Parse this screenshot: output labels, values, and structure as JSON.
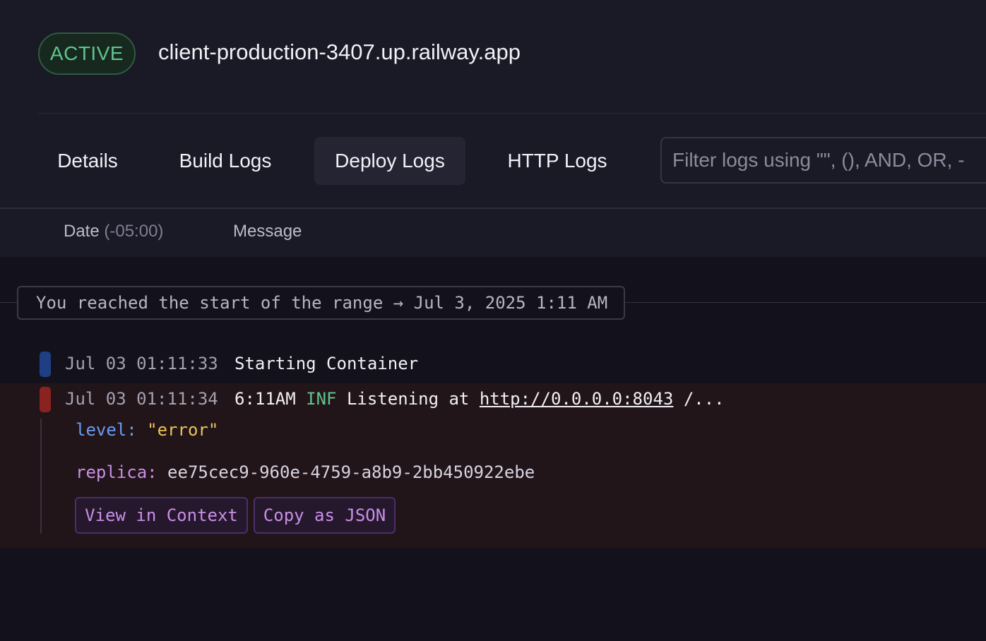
{
  "header": {
    "status_badge": "ACTIVE",
    "url": "client-production-3407.up.railway.app"
  },
  "tabs": [
    {
      "label": "Details",
      "active": false
    },
    {
      "label": "Build Logs",
      "active": false
    },
    {
      "label": "Deploy Logs",
      "active": true
    },
    {
      "label": "HTTP Logs",
      "active": false
    }
  ],
  "filter": {
    "placeholder": "Filter logs using \"\", (), AND, OR, -",
    "value": ""
  },
  "columns": {
    "date": "Date",
    "timezone": "(-05:00)",
    "message": "Message"
  },
  "range_notice": "You reached the start of the range → Jul 3, 2025 1:11 AM",
  "logs": [
    {
      "timestamp": "Jul 03 01:11:33",
      "message": "Starting Container",
      "marker_color": "#1f3f84"
    },
    {
      "timestamp": "Jul 03 01:11:34",
      "time": "6:11AM",
      "level_tag": "INF",
      "text": "Listening at",
      "link": "http://0.0.0.0:8043",
      "suffix": "/...",
      "marker_color": "#8a2320",
      "attributes": {
        "level_key": "level:",
        "level_value": "\"error\"",
        "replica_key": "replica:",
        "replica_value": "ee75cec9-960e-4759-a8b9-2bb450922ebe"
      },
      "actions": {
        "view_in_context": "View in Context",
        "copy_as_json": "Copy as JSON"
      }
    }
  ],
  "colors": {
    "active_green": "#5fc48c",
    "error_row_bg": "#221519",
    "key_blue": "#6a9cf0",
    "key_purple": "#c98ee8",
    "value_yellow": "#e9c35a"
  }
}
